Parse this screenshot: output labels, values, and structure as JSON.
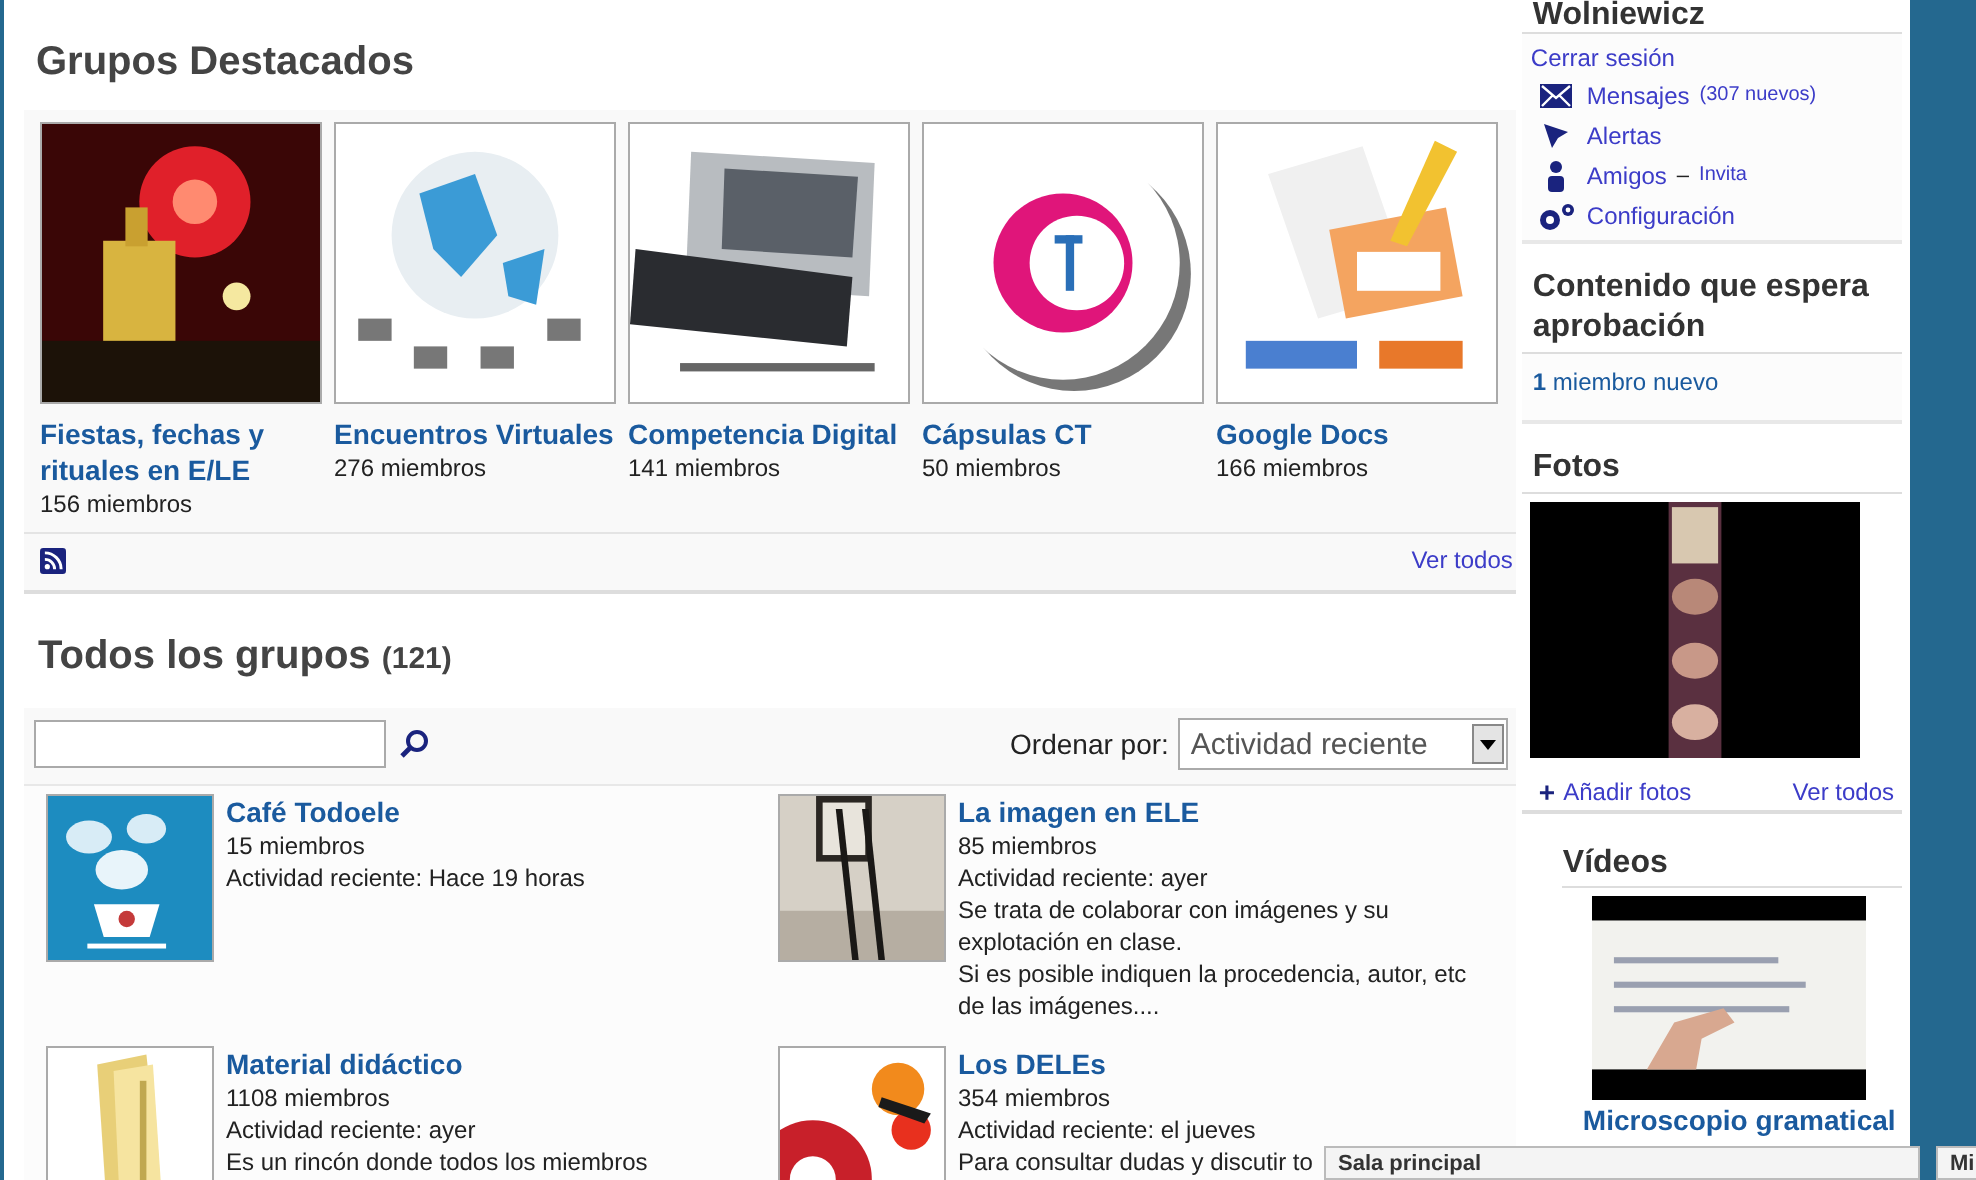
{
  "featured": {
    "title": "Grupos Destacados",
    "groups": [
      {
        "name": "Fiestas, fechas y rituales en E/LE",
        "members": "156 miembros"
      },
      {
        "name": "Encuentros Virtuales",
        "members": "276 miembros"
      },
      {
        "name": "Competencia Digital",
        "members": "141 miembros"
      },
      {
        "name": "Cápsulas CT",
        "members": "50 miembros"
      },
      {
        "name": "Google Docs",
        "members": "166 miembros"
      }
    ],
    "see_all": "Ver todos"
  },
  "all_groups": {
    "title": "Todos los grupos",
    "count": "(121)",
    "sort_label": "Ordenar por:",
    "sort_value": "Actividad reciente",
    "groups": [
      {
        "name": "Café Todoele",
        "members": "15 miembros",
        "activity": "Actividad reciente: Hace 19 horas"
      },
      {
        "name": "La imagen en ELE",
        "members": "85 miembros",
        "activity": "Actividad reciente: ayer",
        "description": [
          "Se trata de colaborar con imágenes y su explotación en clase.",
          "Si es posible indiquen la procedencia, autor, etc de las imágenes...."
        ]
      },
      {
        "name": "Material didáctico",
        "members": "1108 miembros",
        "activity": "Actividad reciente: ayer",
        "description": [
          "Es un rincón donde todos los miembros"
        ]
      },
      {
        "name": "Los DELEs",
        "members": "354 miembros",
        "activity": "Actividad reciente: el jueves",
        "description": [
          "Para consultar dudas y discutir to"
        ]
      }
    ]
  },
  "sidebar": {
    "user": "Wolniewicz",
    "logout": "Cerrar sesión",
    "links": [
      {
        "kind": "messages",
        "label": "Mensajes",
        "extra": "(307 nuevos)"
      },
      {
        "kind": "alerts",
        "label": "Alertas"
      },
      {
        "kind": "friends",
        "label": "Amigos",
        "separator": "–",
        "extra": "Invita"
      },
      {
        "kind": "settings",
        "label": "Configuración"
      }
    ],
    "pending": {
      "title": "Contenido que espera aprobación",
      "count": "1",
      "text": "miembro nuevo"
    },
    "photos": {
      "title": "Fotos",
      "add": "Añadir fotos",
      "add_icon": "+",
      "see_all": "Ver todos"
    },
    "videos": {
      "title": "Vídeos",
      "video_title": "Microscopio gramatical"
    }
  },
  "chat_bar": [
    "Sala principal",
    "Mi"
  ]
}
